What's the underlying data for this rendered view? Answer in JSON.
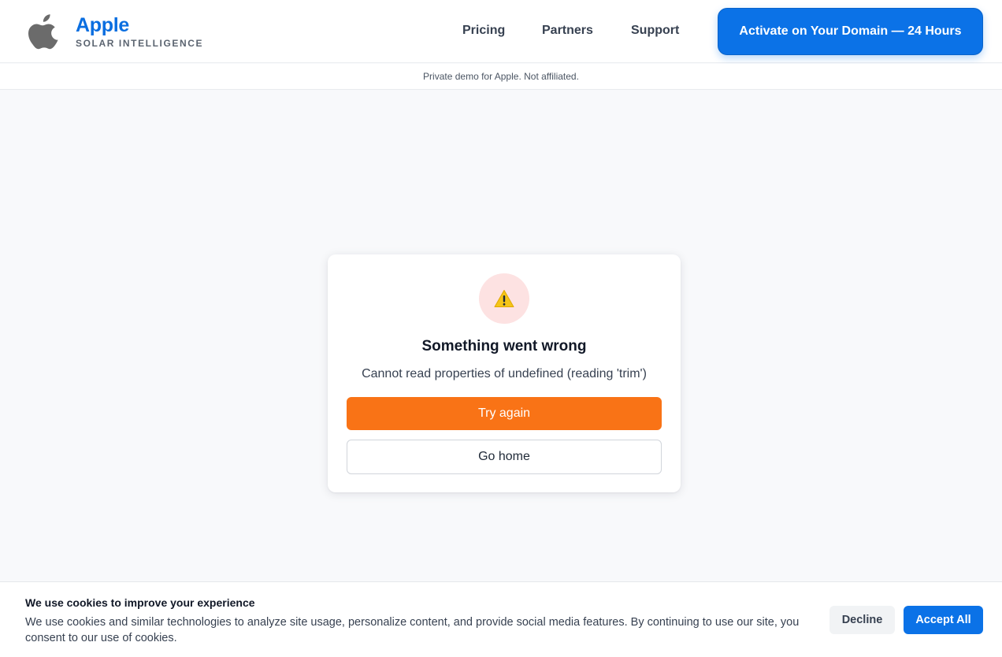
{
  "header": {
    "logo_icon": "apple-logo-icon",
    "brand_name": "Apple",
    "brand_subtitle": "SOLAR INTELLIGENCE",
    "nav": [
      "Pricing",
      "Partners",
      "Support"
    ],
    "cta_label": "Activate on Your Domain — 24 Hours"
  },
  "notice": "Private demo for Apple. Not affiliated.",
  "error_card": {
    "icon": "warning-icon",
    "title": "Something went wrong",
    "message": "Cannot read properties of undefined (reading 'trim')",
    "primary_label": "Try again",
    "secondary_label": "Go home"
  },
  "cookie_banner": {
    "title": "We use cookies to improve your experience",
    "text": "We use cookies and similar technologies to analyze site usage, personalize content, and provide social media features. By continuing to use our site, you consent to our use of cookies.",
    "decline_label": "Decline",
    "accept_label": "Accept All"
  },
  "colors": {
    "brand_blue": "#0b72e7",
    "orange": "#f97316",
    "warning_bg": "#fde2e2"
  }
}
